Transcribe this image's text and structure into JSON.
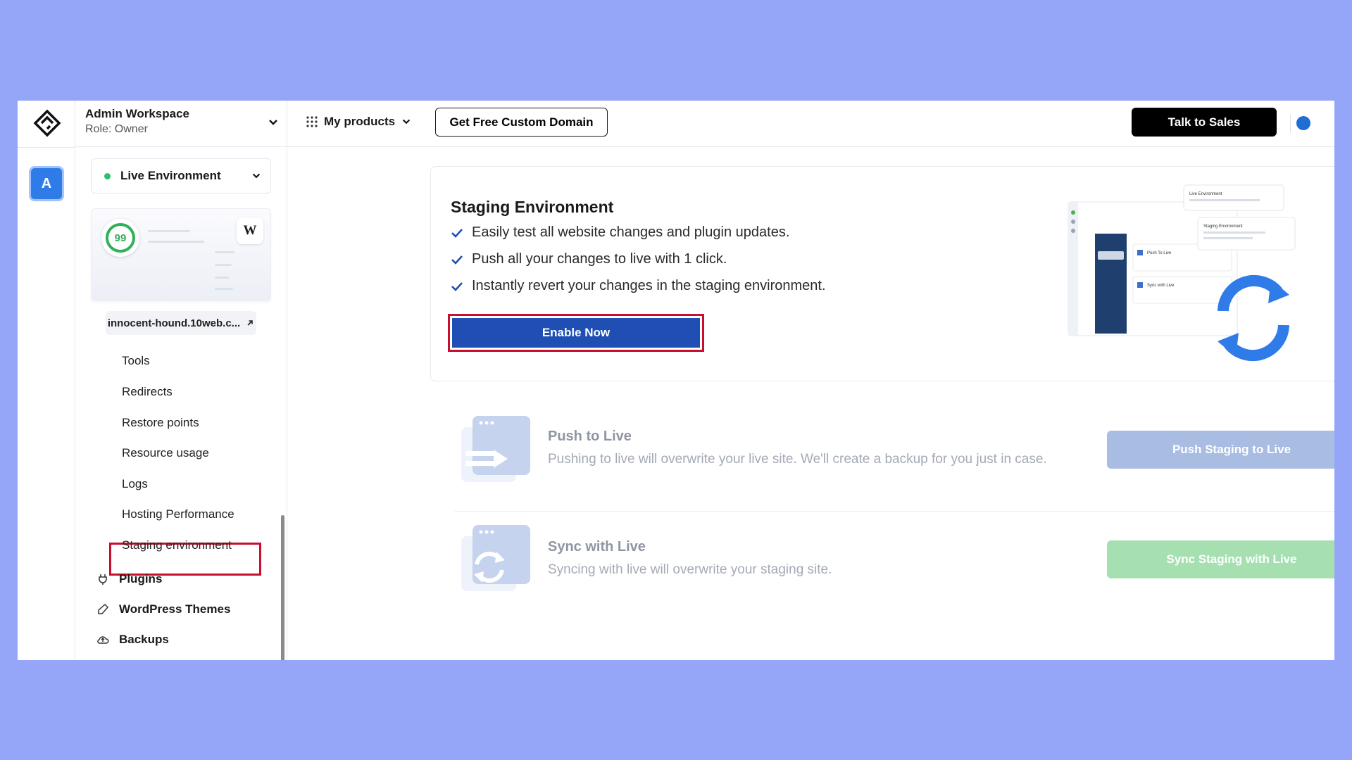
{
  "workspace": {
    "name": "Admin Workspace",
    "role": "Role: Owner",
    "avatar_letter": "A"
  },
  "topbar": {
    "products_label": "My products",
    "domain_button": "Get Free Custom Domain",
    "sales_button": "Talk to Sales"
  },
  "sidebar": {
    "environment": "Live Environment",
    "pagespeed_score": "99",
    "wp_badge": "W",
    "site_url": "innocent-hound.10web.c...",
    "sub_items": [
      "Tools",
      "Redirects",
      "Restore points",
      "Resource usage",
      "Logs",
      "Hosting Performance",
      "Staging environment"
    ],
    "active_item": "Staging environment",
    "main_items": [
      "Plugins",
      "WordPress Themes",
      "Backups"
    ]
  },
  "staging": {
    "title": "Staging Environment",
    "features": [
      "Easily test all website changes and plugin updates.",
      "Push all your changes to live with 1 click.",
      "Instantly revert your changes in the staging environment."
    ],
    "enable_button": "Enable Now",
    "illustration": {
      "live_label": "Live Environment",
      "staging_label": "Staging Environment",
      "push_label": "Push To Live",
      "sync_label": "Sync with Live"
    }
  },
  "actions": [
    {
      "title": "Push to Live",
      "description": "Pushing to live will overwrite your live site. We'll create a backup for you just in case.",
      "button": "Push Staging to Live",
      "button_color": "#a9bde3"
    },
    {
      "title": "Sync with Live",
      "description": "Syncing with live will overwrite your staging site.",
      "button": "Sync Staging with Live",
      "button_color": "#a6e0b1"
    }
  ],
  "colors": {
    "background": "#95a5f7",
    "primary_button": "#1f4fb3",
    "highlight_box": "#c8102e",
    "live_dot": "#26c26e",
    "score_ring": "#2fb05a"
  }
}
